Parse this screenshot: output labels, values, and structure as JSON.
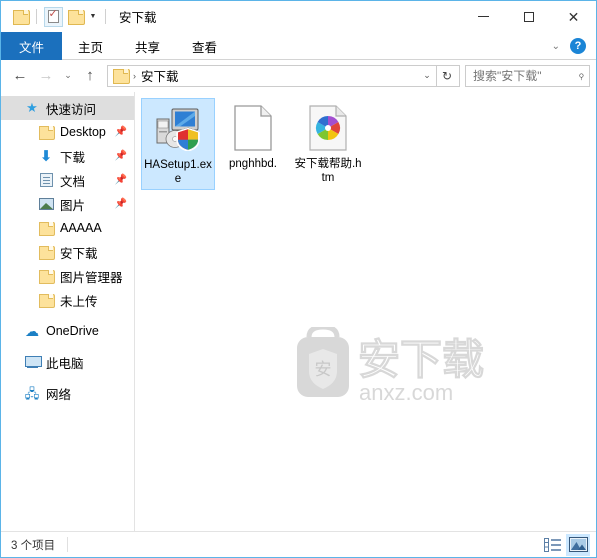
{
  "window": {
    "title": "安下载",
    "quick_access_toolbar": [
      {
        "name": "folder-icon",
        "label": ""
      },
      {
        "name": "properties-icon",
        "label": ""
      },
      {
        "name": "new-folder-icon",
        "label": ""
      },
      {
        "name": "customize-caret",
        "label": "▾"
      }
    ],
    "controls": {
      "minimize": "—",
      "maximize": "▢",
      "close": "✕"
    }
  },
  "ribbon": {
    "tabs": [
      {
        "label": "文件",
        "active": true
      },
      {
        "label": "主页",
        "active": false
      },
      {
        "label": "共享",
        "active": false
      },
      {
        "label": "查看",
        "active": false
      }
    ],
    "expand_caret": "⌄",
    "help_label": "?"
  },
  "navigation": {
    "back": "←",
    "forward": "→",
    "recent": "⌄",
    "up": "↑",
    "breadcrumb": {
      "folder": "安下载",
      "separator": "›"
    },
    "path_caret": "⌄",
    "refresh": "↻"
  },
  "search": {
    "placeholder": "搜索\"安下载\"",
    "icon": "⌕"
  },
  "sidebar": {
    "items": [
      {
        "label": "快速访问",
        "icon": "star-icon",
        "selected": true,
        "indent": 0,
        "pinned": false
      },
      {
        "label": "Desktop",
        "icon": "folder-icon",
        "selected": false,
        "indent": 1,
        "pinned": true
      },
      {
        "label": "下载",
        "icon": "download-icon",
        "selected": false,
        "indent": 1,
        "pinned": true
      },
      {
        "label": "文档",
        "icon": "documents-icon",
        "selected": false,
        "indent": 1,
        "pinned": true
      },
      {
        "label": "图片",
        "icon": "pictures-icon",
        "selected": false,
        "indent": 1,
        "pinned": true
      },
      {
        "label": "AAAAA",
        "icon": "folder-icon",
        "selected": false,
        "indent": 1,
        "pinned": false
      },
      {
        "label": "安下载",
        "icon": "folder-icon",
        "selected": false,
        "indent": 1,
        "pinned": false
      },
      {
        "label": "图片管理器",
        "icon": "folder-icon",
        "selected": false,
        "indent": 1,
        "pinned": false
      },
      {
        "label": "未上传",
        "icon": "folder-icon",
        "selected": false,
        "indent": 1,
        "pinned": false
      },
      {
        "label": "OneDrive",
        "icon": "cloud-icon",
        "selected": false,
        "indent": 0,
        "pinned": false
      },
      {
        "label": "此电脑",
        "icon": "this-pc-icon",
        "selected": false,
        "indent": 0,
        "pinned": false
      },
      {
        "label": "网络",
        "icon": "network-icon",
        "selected": false,
        "indent": 0,
        "pinned": false
      }
    ]
  },
  "files": [
    {
      "name": "HASetup1.exe",
      "icon": "setup-exe-icon",
      "selected": true
    },
    {
      "name": "pnghhbd.",
      "icon": "blank-file-icon",
      "selected": false
    },
    {
      "name": "安下载帮助.htm",
      "icon": "html-pinwheel-icon",
      "selected": false
    }
  ],
  "watermark": {
    "text": "安",
    "brand": "安下载",
    "domain": "anxz.com"
  },
  "statusbar": {
    "item_count": "3 个项目",
    "views": [
      {
        "name": "details-view-icon",
        "active": false
      },
      {
        "name": "large-icons-view-icon",
        "active": true
      }
    ]
  },
  "colors": {
    "accent": "#1b70bd",
    "selection": "#cce8ff",
    "window_border": "#5bb4e8",
    "folder": "#fde29b"
  }
}
